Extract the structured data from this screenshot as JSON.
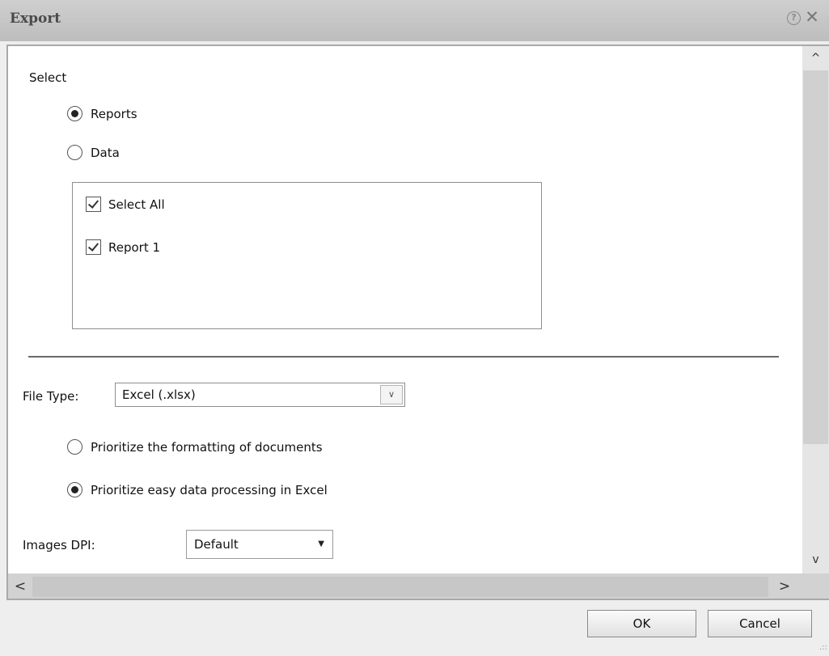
{
  "window": {
    "title": "Export",
    "help_icon": "?",
    "close_icon": "✕"
  },
  "select_section": {
    "label": "Select",
    "options": [
      {
        "label": "Reports",
        "selected": true
      },
      {
        "label": "Data",
        "selected": false
      }
    ],
    "report_list": [
      {
        "label": "Select All",
        "checked": true
      },
      {
        "label": "Report 1",
        "checked": true
      }
    ]
  },
  "file_type": {
    "label": "File Type:",
    "value": "Excel (.xlsx)",
    "arrow_icon": "chevron-down-icon"
  },
  "excel_options": [
    {
      "label": "Prioritize the formatting of documents",
      "selected": false
    },
    {
      "label": "Prioritize easy data processing in Excel",
      "selected": true
    }
  ],
  "images_dpi": {
    "label": "Images DPI:",
    "value": "Default",
    "arrow": "▼"
  },
  "scrollbars": {
    "up": "^",
    "down": "v",
    "left": "<",
    "right": ">"
  },
  "buttons": {
    "ok": "OK",
    "cancel": "Cancel"
  },
  "resize_grip": ".::"
}
